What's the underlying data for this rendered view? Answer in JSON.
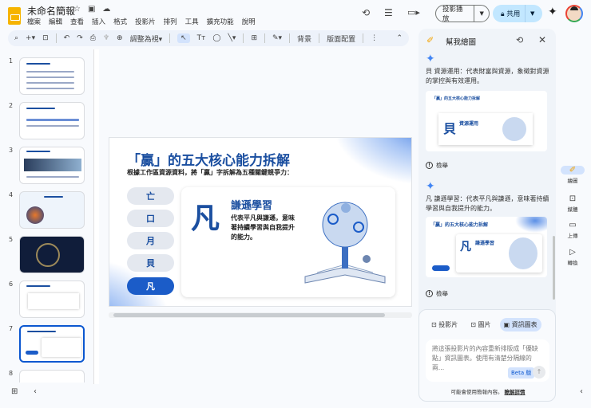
{
  "header": {
    "doc_title": "未命名簡報",
    "menu": [
      "檔案",
      "編輯",
      "查看",
      "插入",
      "格式",
      "投影片",
      "排列",
      "工具",
      "擴充功能",
      "說明"
    ],
    "present_label": "投影播放",
    "share_label": "共用"
  },
  "toolbar": {
    "fit_label": "調整為視",
    "background_label": "背景",
    "layout_label": "版面配置"
  },
  "filmstrip": {
    "slides": [
      "1",
      "2",
      "3",
      "4",
      "5",
      "6",
      "7",
      "8"
    ],
    "active": 7
  },
  "slide": {
    "title": "「贏」的五大核心能力拆解",
    "subtitle": "根據工作區資源資料，將「贏」字拆解為五種關鍵競爭力：",
    "parts": [
      "亡",
      "口",
      "月",
      "貝",
      "凡"
    ],
    "selected_char": "凡",
    "card_heading": "謙遜學習",
    "card_text": "代表平凡與謙遜，意味著持續學習與自我提升的能力。"
  },
  "panel": {
    "title": "幫我繪圖",
    "msg1": "貝 資源運用：代表財富與資源，象徵對資源的掌控與有效運用。",
    "thumb1_heading": "資源運用",
    "msg2": "凡 謙遜學習：代表平凡與謙遜，意味著持續學習與自我提升的能力。",
    "report_label": "檢舉",
    "tabs": [
      "投影片",
      "圖片",
      "資訊圖表"
    ],
    "prompt": "將這張投影片的內容重新排版成「優缺點」資訊圖表。使用有清楚分隔線的兩...",
    "beta": "Beta 版",
    "footer": "可能會使用簡報內容。",
    "footer_link": "瞭解詳情"
  },
  "rail": [
    "繪圖",
    "媒體",
    "上傳",
    "轉換"
  ],
  "colors": {
    "accent": "#0b57d0",
    "slide_blue": "#1b4fa0"
  }
}
